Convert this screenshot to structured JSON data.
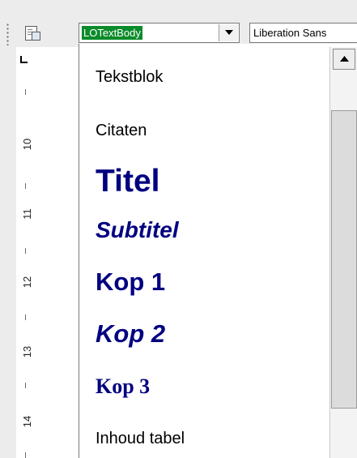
{
  "toolbar": {
    "paragraph_style": "LOTextBody",
    "font_name": "Liberation Sans"
  },
  "ruler": {
    "numbers": [
      "10",
      "11",
      "12",
      "13",
      "14"
    ]
  },
  "style_list": {
    "items": [
      "Tekstblok",
      "Citaten",
      "Titel",
      "Subtitel",
      "Kop 1",
      "Kop 2",
      "Kop 3",
      "Inhoud tabel"
    ]
  },
  "colors": {
    "heading": "#000080",
    "selection": "#0b8b2a"
  }
}
